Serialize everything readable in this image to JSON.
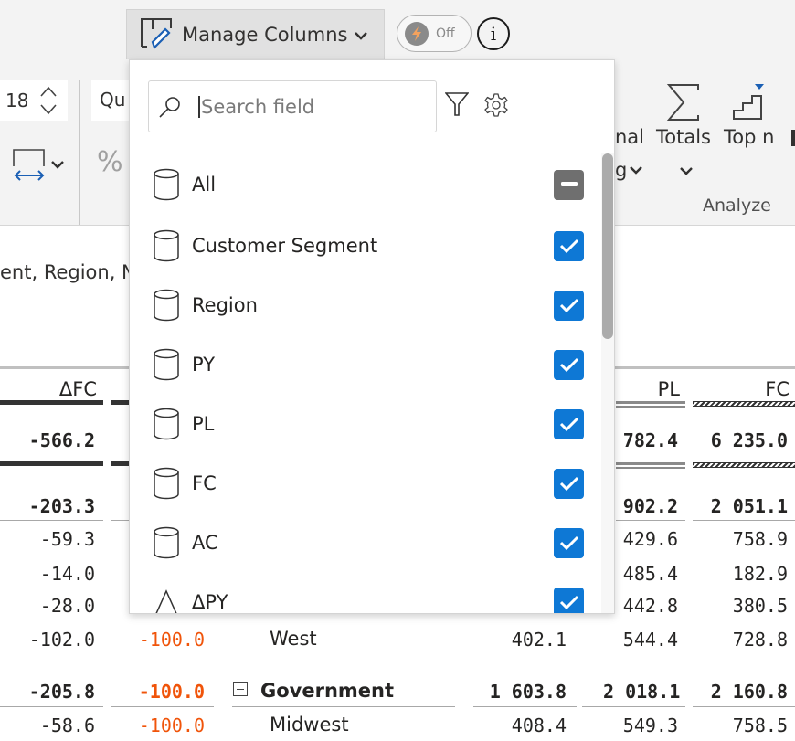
{
  "toolbar": {
    "manage_columns_label": "Manage Columns",
    "toggle_label": "Off",
    "toggle_state": "off",
    "info_label": "i",
    "font_size_value": "18",
    "font_family_partial": "Qu",
    "percent_symbol": "%",
    "formatting_partial_line1": "nal",
    "formatting_partial_line2": "g",
    "totals_label": "Totals",
    "topn_label": "Top n",
    "analyze_group_label": "Analyze",
    "accent_color": "#1a5fb4"
  },
  "report": {
    "subtitle_partial": "ent, Region, N",
    "columns": {
      "dfc": "ΔFC",
      "pl": "PL",
      "fc": "FC"
    },
    "rows": [
      {
        "type": "grand-total",
        "dfc": "-566.2",
        "pl": "782.4",
        "fc": "6 235.0"
      },
      {
        "type": "subtotal",
        "dfc": "-203.3",
        "pl": "902.2",
        "fc": "2 051.1"
      },
      {
        "type": "detail",
        "dfc": "-59.3",
        "pl": "429.6",
        "fc": "758.9"
      },
      {
        "type": "detail",
        "dfc": "-14.0",
        "pl": "485.4",
        "fc": "182.9"
      },
      {
        "type": "detail",
        "dfc": "-28.0",
        "pl": "442.8",
        "fc": "380.5"
      },
      {
        "type": "detail",
        "dfc": "-102.0",
        "dpy_pct": "-100.0",
        "label": "West",
        "py": "402.1",
        "pl": "544.4",
        "fc": "728.8"
      },
      {
        "type": "subtotal",
        "dfc": "-205.8",
        "dpy_pct": "-100.0",
        "label": "Government",
        "py": "1 603.8",
        "pl": "2 018.1",
        "fc": "2 160.8"
      },
      {
        "type": "detail",
        "dfc": "-58.6",
        "dpy_pct": "-100.0",
        "label": "Midwest",
        "py": "408.4",
        "pl": "549.3",
        "fc": "758.5"
      }
    ],
    "negative_color": "#f0540a"
  },
  "popup": {
    "search_placeholder": "Search field",
    "search_value": "",
    "items": [
      {
        "label": "All",
        "icon": "cylinder-icon",
        "state": "partial"
      },
      {
        "label": "Customer Segment",
        "icon": "cylinder-icon",
        "state": "checked"
      },
      {
        "label": "Region",
        "icon": "cylinder-icon",
        "state": "checked"
      },
      {
        "label": "PY",
        "icon": "cylinder-icon",
        "state": "checked"
      },
      {
        "label": "PL",
        "icon": "cylinder-icon",
        "state": "checked"
      },
      {
        "label": "FC",
        "icon": "cylinder-icon",
        "state": "checked"
      },
      {
        "label": "AC",
        "icon": "cylinder-icon",
        "state": "checked"
      },
      {
        "label": "ΔPY",
        "icon": "triangle-icon",
        "state": "checked"
      }
    ],
    "checkbox_color": "#0e78d5",
    "partial_color": "#6f6f6f"
  }
}
